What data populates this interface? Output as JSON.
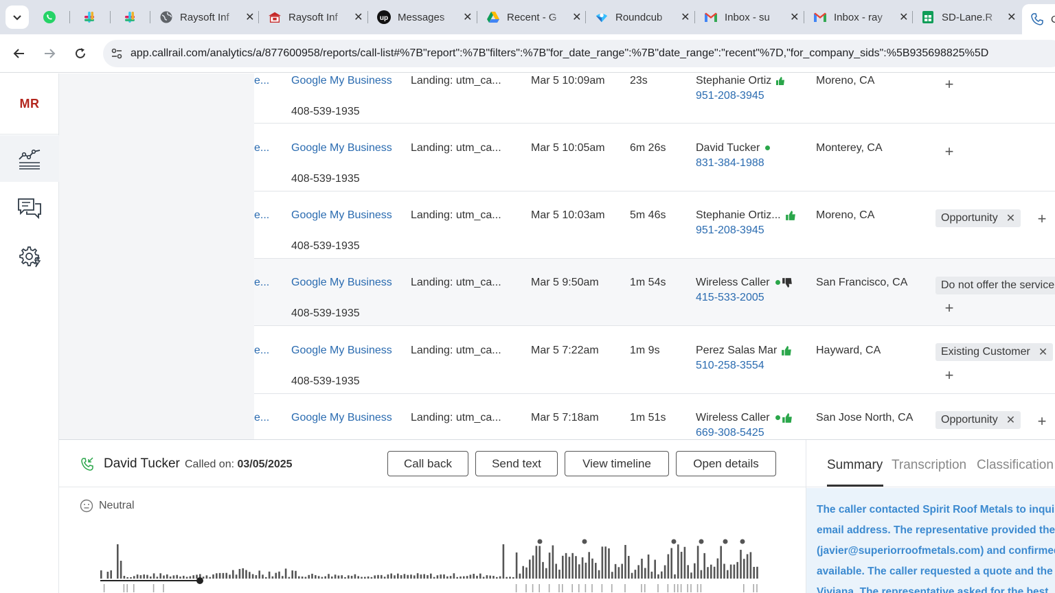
{
  "browser": {
    "tabs": [
      {
        "label": "",
        "icon": "whatsapp-icon"
      },
      {
        "label": "",
        "icon": "slack-icon"
      },
      {
        "label": "",
        "icon": "slack-icon"
      },
      {
        "label": "Raysoft Inf",
        "icon": "globe-icon"
      },
      {
        "label": "Raysoft Inf",
        "icon": "raysoft-icon"
      },
      {
        "label": "Messages",
        "icon": "upwork-icon"
      },
      {
        "label": "Recent - G",
        "icon": "google-drive-icon"
      },
      {
        "label": "Roundcub",
        "icon": "roundcube-icon"
      },
      {
        "label": "Inbox - su",
        "icon": "gmail-icon"
      },
      {
        "label": "Inbox - ray",
        "icon": "gmail-icon"
      },
      {
        "label": "SD-Lane.R",
        "icon": "google-sheets-icon"
      },
      {
        "label": "C",
        "icon": "callrail-icon"
      }
    ],
    "url": "app.callrail.com/analytics/a/877600958/reports/call-list#%7B\"report\":%7B\"filters\":%7B\"for_date_range\":%7B\"date_range\":\"recent\"%7D,\"for_company_sids\":%5B935698825%5D"
  },
  "app": {
    "logo": "MR"
  },
  "rows": [
    {
      "col0": "e...",
      "source": "Google My Business",
      "tracking_number": "408-539-1935",
      "landing": "Landing: utm_ca...",
      "datetime": "Mar 5 10:09am",
      "duration": "23s",
      "caller": "Stephanie Ortiz",
      "phone": "951-208-3945",
      "location": "Moreno, CA",
      "indicator": "thumb-up-icon",
      "tags": []
    },
    {
      "col0": "e...",
      "source": "Google My Business",
      "tracking_number": "408-539-1935",
      "landing": "Landing: utm_ca...",
      "datetime": "Mar 5 10:05am",
      "duration": "6m 26s",
      "caller": "David Tucker",
      "phone": "831-384-1988",
      "location": "Monterey, CA",
      "indicator": "green-dot",
      "tags": []
    },
    {
      "col0": "e...",
      "source": "Google My Business",
      "tracking_number": "408-539-1935",
      "landing": "Landing: utm_ca...",
      "datetime": "Mar 5 10:03am",
      "duration": "5m 46s",
      "caller": "Stephanie Ortiz...",
      "phone": "951-208-3945",
      "location": "Moreno, CA",
      "indicator": "thumb-up-icon",
      "tags": [
        "Opportunity"
      ]
    },
    {
      "col0": "e...",
      "source": "Google My Business",
      "tracking_number": "408-539-1935",
      "landing": "Landing: utm_ca...",
      "datetime": "Mar 5 9:50am",
      "duration": "1m 54s",
      "caller": "Wireless Caller",
      "phone": "415-533-2005",
      "location": "San Francisco, CA",
      "indicator": "thumb-down-icon",
      "tags": [
        "Do not offer the service"
      ]
    },
    {
      "col0": "e...",
      "source": "Google My Business",
      "tracking_number": "408-539-1935",
      "landing": "Landing: utm_ca...",
      "datetime": "Mar 5 7:22am",
      "duration": "1m 9s",
      "caller": "Perez Salas Mar",
      "phone": "510-258-3554",
      "location": "Hayward, CA",
      "indicator": "thumb-up-icon",
      "tags": [
        "Existing Customer"
      ]
    },
    {
      "col0": "e...",
      "source": "Google My Business",
      "tracking_number": "",
      "landing": "Landing: utm_ca...",
      "datetime": "Mar 5 7:18am",
      "duration": "1m 51s",
      "caller": "Wireless Caller",
      "phone": "669-308-5425",
      "location": "San Jose North, CA",
      "indicator": "thumb-up-icon",
      "tags": [
        "Opportunity"
      ]
    }
  ],
  "panel": {
    "caller_name": "David Tucker",
    "called_on_label": "Called on:",
    "called_on_date": "03/05/2025",
    "buttons": {
      "call_back": "Call back",
      "send_text": "Send text",
      "view_timeline": "View timeline",
      "open_details": "Open details"
    },
    "sentiment": "Neutral",
    "tabs": {
      "summary": "Summary",
      "transcription": "Transcription",
      "classification": "Classification"
    },
    "summary_lines": [
      "The caller contacted Spirit Roof Metals to inquire",
      "email address. The representative provided the",
      "(javier@superiorroofmetals.com) and confirmed",
      "available. The caller requested a quote and the",
      "Viviana. The representative asked for the best"
    ]
  }
}
